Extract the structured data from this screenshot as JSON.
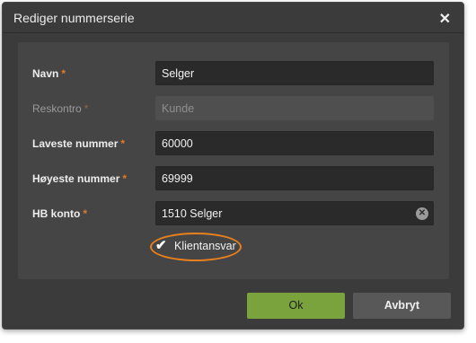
{
  "dialog": {
    "title": "Rediger nummerserie",
    "close_icon": "close-icon"
  },
  "form": {
    "required_marker": "*",
    "fields": [
      {
        "label": "Navn",
        "value": "Selger",
        "disabled": false
      },
      {
        "label": "Reskontro",
        "value": "Kunde",
        "disabled": true
      },
      {
        "label": "Laveste nummer",
        "value": "60000",
        "disabled": false
      },
      {
        "label": "Høyeste nummer",
        "value": "69999",
        "disabled": false
      },
      {
        "label": "HB konto",
        "value": "1510 Selger",
        "disabled": false,
        "clearable": true
      }
    ],
    "checkbox": {
      "label": "Klientansvar",
      "checked": true,
      "highlighted": true
    }
  },
  "buttons": {
    "ok": "Ok",
    "cancel": "Avbryt"
  },
  "colors": {
    "accent": "#e07a28",
    "ok_button": "#7aa23d",
    "dialog_bg": "#3b3b3b",
    "panel_bg": "#454545"
  }
}
